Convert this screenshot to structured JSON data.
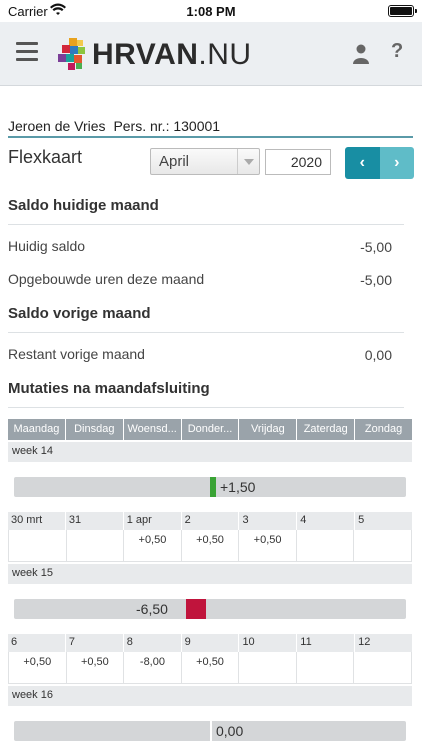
{
  "status": {
    "carrier": "Carrier",
    "time": "1:08 PM"
  },
  "header": {
    "brand_bold": "HRVAN",
    "brand_light": ".NU",
    "help": "?"
  },
  "employee": {
    "name": "Jeroen de Vries",
    "pers": "Pers. nr.: 130001"
  },
  "page": {
    "title": "Flexkaart",
    "month": "April",
    "year": "2020",
    "prev": "‹",
    "next": "›"
  },
  "saldo_huidig": {
    "heading": "Saldo huidige maand",
    "rows": [
      {
        "label": "Huidig saldo",
        "value": "-5,00"
      },
      {
        "label": "Opgebouwde uren deze maand",
        "value": "-5,00"
      }
    ]
  },
  "saldo_vorig": {
    "heading": "Saldo vorige maand",
    "rows": [
      {
        "label": "Restant vorige maand",
        "value": "0,00"
      }
    ]
  },
  "mutaties": {
    "heading": "Mutaties na maandafsluiting",
    "days": [
      "Maandag",
      "Dinsdag",
      "Woensd...",
      "Donder...",
      "Vrijdag",
      "Zaterdag",
      "Zondag"
    ],
    "weeks": [
      {
        "label": "week 14",
        "saldo": "+1,50",
        "saldo_value": 1.5,
        "mark_color": "#3aa335",
        "dates": [
          "30 mrt",
          "31",
          "1 apr",
          "2",
          "3",
          "4",
          "5"
        ],
        "values": [
          "",
          "",
          "+0,50",
          "+0,50",
          "+0,50",
          "",
          ""
        ]
      },
      {
        "label": "week 15",
        "saldo": "-6,50",
        "saldo_value": -6.5,
        "mark_color": "#c0143c",
        "dates": [
          "6",
          "7",
          "8",
          "9",
          "10",
          "11",
          "12"
        ],
        "values": [
          "+0,50",
          "+0,50",
          "-8,00",
          "+0,50",
          "",
          "",
          ""
        ]
      },
      {
        "label": "week 16",
        "saldo": "0,00",
        "saldo_value": 0,
        "mark_color": "#ffffff"
      }
    ]
  }
}
